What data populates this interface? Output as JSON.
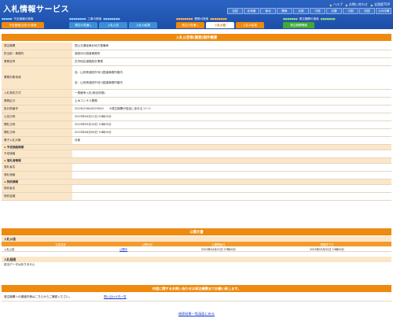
{
  "header": {
    "app_title": "入札情報サービス",
    "util_links": [
      "ヘルプ",
      "お問い合わせ",
      "全国版TOP"
    ],
    "prefectures": [
      "全国",
      "北海道",
      "東北",
      "関東",
      "北陸",
      "中部",
      "近畿",
      "中国",
      "四国",
      "九州沖縄"
    ],
    "categories": [
      {
        "label": "予定価格の検索",
        "buttons": [
          "予定価格(目安)の検索"
        ]
      },
      {
        "label": "工事の検索",
        "buttons": [
          "発注の見通し",
          "入札公告",
          "入札の結果"
        ]
      },
      {
        "label": "業務の検索",
        "buttons": [
          "発注の見通し",
          "入札公告",
          "入札の結果"
        ]
      },
      {
        "label": "発注機関の検索",
        "buttons": [
          "発注機関情報"
        ]
      }
    ]
  },
  "detail": {
    "title": "入札公告等(業務)案件概要",
    "rows": [
      {
        "label": "発注機関",
        "value": [
          "国土交通省東北地方整備局"
        ]
      },
      {
        "label": "担当部・事務所",
        "value": [
          "酒田河川国道事務所"
        ]
      },
      {
        "label": "業務名称",
        "value": [
          "庄内地区道路設計業務"
        ]
      },
      {
        "label": "業務対象地域",
        "value": [
          "自：山形県酒田市河川国道事務所管内",
          "至：山形県酒田市河川国道事務所管内"
        ]
      },
      {
        "label": "入札契約方式",
        "value": [
          "一般競争入札(総合評価)"
        ]
      },
      {
        "label": "業務区分",
        "value": [
          "土木コンサル業務"
        ]
      },
      {
        "label": "設計書番号",
        "value": [
          "20230256A0029000　　※発注機関が独自に定めるコード"
        ]
      },
      {
        "label": "公告日時",
        "value": [
          "2023年04月21日 00時00分"
        ]
      },
      {
        "label": "開札日時",
        "value": [
          "2023年05月16日 10時00分"
        ]
      },
      {
        "label": "開札日時",
        "value": [
          "2023年06月06日 10時00分"
        ]
      },
      {
        "label": "電子入札対象",
        "value": [
          "対象"
        ]
      }
    ],
    "group_price": "予定価格情報",
    "price_rows": [
      {
        "label": "予定価格",
        "value": [
          ""
        ]
      }
    ],
    "group_winner": "落札者情報",
    "winner_rows": [
      {
        "label": "落札者名",
        "value": [
          ""
        ]
      },
      {
        "label": "落札価格",
        "value": [
          ""
        ]
      }
    ],
    "group_contract": "契約情報",
    "contract_rows": [
      {
        "label": "契約者名",
        "value": [
          ""
        ]
      },
      {
        "label": "契約金額",
        "value": [
          ""
        ]
      }
    ]
  },
  "documents": {
    "title": "公開文書",
    "sub_heading": "入札公告",
    "columns": [
      "文書名称",
      "公開状況",
      "公開開始日",
      "掲載終了日"
    ],
    "rows": [
      {
        "name": "入札公告",
        "status": "公開中",
        "start": "2023年04月21日 07時00分",
        "end": "2023年05月31日 23時00分"
      }
    ],
    "result_heading": "入札経過",
    "no_data": "該当データはありません"
  },
  "contact": {
    "bar": "内容に関するお問い合わせは発注機関までお願い致します。",
    "text": "発注機関への連絡先等はこちらからご確認ください。",
    "link": "問い合わせ先一覧"
  },
  "back_link": "検索結果一覧画面に戻る",
  "colors": {
    "header": "#1d4ea8",
    "accent": "#ee8a0f",
    "label_bg": "#fbe6c8",
    "link": "#1a3fd6"
  }
}
